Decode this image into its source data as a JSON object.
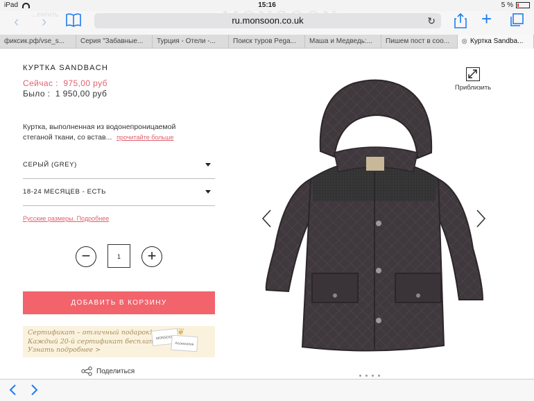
{
  "status": {
    "device": "iPad",
    "time": "15:16",
    "battery": "5 %"
  },
  "browser": {
    "url": "ru.monsoon.co.uk",
    "ghost_logo": "MONSOON",
    "ghost_link": "...ентить",
    "tabs": [
      {
        "label": "фиксик.рф/vse_s..."
      },
      {
        "label": "Серия \"Забавные..."
      },
      {
        "label": "Турция - Отели -..."
      },
      {
        "label": "Поиск туров Pega..."
      },
      {
        "label": "Маша и Медведь:..."
      },
      {
        "label": "Пишем пост в соо..."
      },
      {
        "label": "Куртка Sandba..."
      }
    ]
  },
  "product": {
    "title": "КУРТКА SANDBACH",
    "price_now_label": "Сейчас :",
    "price_now": "975,00 руб",
    "price_was_label": "Было :",
    "price_was": "1 950,00 руб",
    "description": "Куртка, выполненная из водонепроницаемой стеганой ткани, со встав...",
    "read_more": "прочитайте больше",
    "color_select": "СЕРЫЙ (GREY)",
    "size_select": "18-24 МЕСЯЦЕВ - ЕСТЬ",
    "sizes_link": "Русские размеры. Подробнее",
    "quantity": "1",
    "add_to_cart": "ДОБАВИТЬ В КОРЗИНУ",
    "zoom_label": "Приблизить",
    "share_label": "Поделиться"
  },
  "banner": {
    "line1": "Сертификат – отличный подарок!",
    "line2": "Каждый 20-й сертификат бесплатно.",
    "line3": "Узнать подробнее >",
    "card1": "MONSOON",
    "card2": "Accessorize"
  },
  "colors": {
    "accent_pink": "#f2636c",
    "ios_blue": "#1e7cf2",
    "jacket": "#3f383c"
  }
}
